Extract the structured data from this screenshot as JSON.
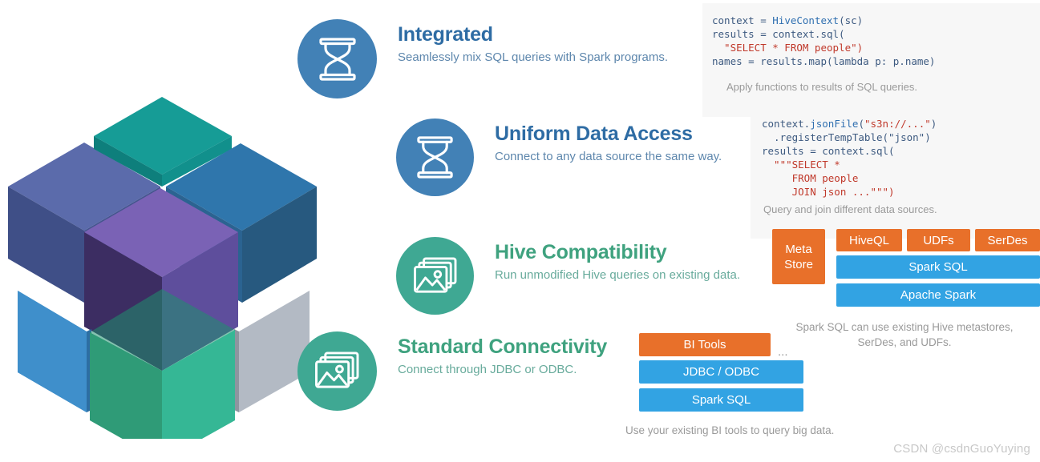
{
  "features": [
    {
      "id": "integrated",
      "icon": "hourglass-icon",
      "title": "Integrated",
      "subtitle": "Seamlessly mix SQL queries with Spark programs.",
      "circle_color": "#4281b6",
      "title_color": "#2e6ca4"
    },
    {
      "id": "uniform-data-access",
      "icon": "hourglass-icon",
      "title": "Uniform Data Access",
      "subtitle": "Connect to any data source the same way.",
      "circle_color": "#4281b6",
      "title_color": "#2e6ca4"
    },
    {
      "id": "hive-compatibility",
      "icon": "photos-icon",
      "title": "Hive Compatibility",
      "subtitle": "Run unmodified Hive queries on existing data.",
      "circle_color": "#3fa893",
      "title_color": "#3fa27f"
    },
    {
      "id": "standard-connectivity",
      "icon": "photos-icon",
      "title": "Standard Connectivity",
      "subtitle": "Connect through JDBC or ODBC.",
      "circle_color": "#3fa893",
      "title_color": "#3fa27f"
    }
  ],
  "code_integrated": {
    "line1_a": "context = ",
    "line1_b": "HiveContext",
    "line1_c": "(sc)",
    "line2": "results = context.sql(",
    "line3": "  \"SELECT * FROM people\")",
    "line4": "names = results.map(lambda p: p.name)",
    "caption": "Apply functions to results of SQL queries."
  },
  "code_uniform": {
    "line1_a": "context.",
    "line1_b": "jsonFile",
    "line1_c": "(",
    "line1_d": "\"s3n://...\"",
    "line1_e": ")",
    "line2": "  .registerTempTable(\"json\")",
    "line3": "results = context.sql(",
    "line4": "  \"\"\"SELECT *",
    "line5": "     FROM people",
    "line6": "     JOIN json ...\"\"\")",
    "caption": "Query and join different data sources."
  },
  "hive_stack": {
    "metastore": "Meta\nStore",
    "metastore_line1": "Meta",
    "metastore_line2": "Store",
    "hiveql": "HiveQL",
    "udfs": "UDFs",
    "serdes": "SerDes",
    "spark_sql": "Spark SQL",
    "apache_spark": "Apache Spark",
    "note_line1": "Spark SQL can use existing Hive metastores,",
    "note_line2": "SerDes, and UDFs."
  },
  "connectivity_stack": {
    "bi_tools": "BI Tools",
    "ellipsis": "...",
    "jdbc_odbc": "JDBC / ODBC",
    "spark_sql": "Spark SQL",
    "caption": "Use your existing BI tools to query big data."
  },
  "colors": {
    "orange": "#e8702a",
    "blue": "#32a3e3",
    "feature_blue": "#4281b6",
    "feature_green": "#3fa893",
    "code_bg": "#f7f7f7"
  },
  "watermark": "CSDN @csdnGuoYuying"
}
